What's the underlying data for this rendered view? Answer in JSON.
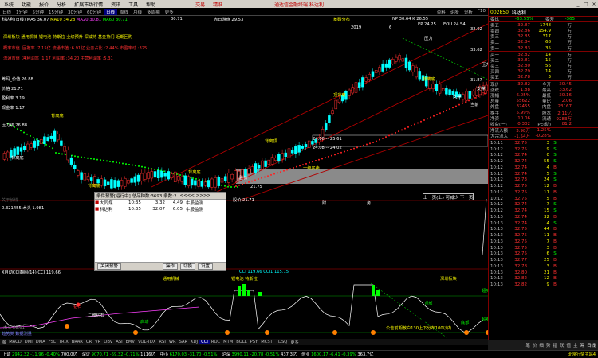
{
  "window": {
    "title": "通达信金融终端 科达利",
    "menu": [
      "系统",
      "功能",
      "报价",
      "分析",
      "扩展市场行情",
      "资讯",
      "工具",
      "帮助"
    ],
    "trade_label": "交易",
    "weituo_label": "精准"
  },
  "toolbar": {
    "items": [
      "日线",
      "1分钟",
      "5分钟",
      "15分钟",
      "30分钟",
      "60分钟",
      "日线",
      "周线",
      "月线",
      "多周期",
      "更多"
    ],
    "active_index": 6,
    "right_items": [
      "资料",
      "论股",
      "分析",
      "F10"
    ]
  },
  "chart_header": {
    "stock": "科达利(日线)",
    "ma5": "MA5 36.07",
    "ma10": "MA10 34.28",
    "ma20": "MA20 30.81",
    "ma60": "MA60 30.71",
    "ma120": "30.71",
    "extra": "赤日游盘 29.53",
    "extra2": "筹码分布",
    "np": "NP 30.64",
    "ma_lbl": "K",
    "rt": "NP 30.64  K 26.55",
    "ep": "EP 24.25",
    "eo": "EOU 24.54",
    "rt2": "24.49",
    "rt3": "32.02",
    "rt4": "33.62",
    "rt5": "31.87",
    "year": "2019",
    "year2": "6"
  },
  "overlay_text": {
    "line1": "深圳板块 通用机械 锂电池 特斯拉 业绩预升 深减持 基金持门 近期回购",
    "line2": "概率市值 :回撤率 :7.15亿 流通市值 :6.91亿 业务占比 :2.44% 市盈率动 :325",
    "line3": "流通市值 :净利润率 :1.17  利润率 :34.20  主营利润率 :5.31",
    "l_a": "筹码_价值 26.88",
    "l_b": "价格 21.71",
    "l_c": "盈利率 3.19",
    "l_d": "现金率 1.17",
    "l_e": "压力线 26.88",
    "l_f": "关于长线",
    "l_g": "0.321455 木头 1.981",
    "mark1": "背离底",
    "mark2": "背离底",
    "mark3": "背离底",
    "mark4": "背离顶",
    "mark5": "顶背离",
    "mark6": "背离底",
    "mark7": "压力",
    "mark8": "支撑",
    "mark9": "压力",
    "mark10": "支撑",
    "mark11": "当前",
    "mark12": "背离底",
    "box1": "24.00 -- 25.61",
    "box2": "24.08 -- 24.02",
    "box3": "一级买卖",
    "box4": "股价",
    "box5": "21.75",
    "box6": "股价 21.71",
    "tick1": "财",
    "tick2": "务",
    "tick3": "目标",
    "tick4": "目标",
    "sep_lbl": "木头 28.61"
  },
  "indicator": {
    "title": "X自动CCI翻图(14) CCI 119.66",
    "vals": "CCI 119.66  CCI1 115.15",
    "labels": [
      "通用机械",
      "锂电池 特斯拉",
      "深圳板块",
      "钻石",
      "二维钻石",
      "超买",
      "超卖",
      "启动",
      "公告前期散户130上下分布100以内",
      "顶部",
      "底部"
    ],
    "left_lbl": "趋势类 数据测量"
  },
  "popup": {
    "title": "条件预警[运行中] 总品种数:3693 条数:2",
    "arrows": "<<<< >>>>",
    "rows": [
      {
        "flag": "大同煤",
        "time": "10:35",
        "price": "3.32",
        "pct": "4.49",
        "sig": "牛股监测"
      },
      {
        "flag": "科达利",
        "time": "10:35",
        "price": "32.07",
        "pct": "6.05",
        "sig": "牛股监测"
      }
    ],
    "buttons": [
      "关闭预警",
      "操作",
      "切换",
      "设置"
    ]
  },
  "tooltip": "上一页(上) 可减少 下一页",
  "right_panel": {
    "code": "002850",
    "name": "科达利",
    "compare": "委比",
    "compare_val": "-63.55%",
    "weicha": "委差",
    "weicha_val": "-365",
    "sells": [
      {
        "l": "卖五",
        "p": "32.87",
        "v": "1748",
        "c": "万"
      },
      {
        "l": "卖四",
        "p": "32.86",
        "v": "154.9",
        "c": "万"
      },
      {
        "l": "卖三",
        "p": "32.85",
        "v": "317",
        "c": "万"
      },
      {
        "l": "卖二",
        "p": "32.84",
        "v": "68",
        "c": "万"
      },
      {
        "l": "卖一",
        "p": "32.83",
        "v": "35",
        "c": "万"
      }
    ],
    "buys": [
      {
        "l": "买一",
        "p": "32.82",
        "v": "14",
        "c": "万"
      },
      {
        "l": "买二",
        "p": "32.81",
        "v": "15",
        "c": "万"
      },
      {
        "l": "买三",
        "p": "32.80",
        "v": "56",
        "c": "万"
      },
      {
        "l": "买四",
        "p": "32.79",
        "v": "14",
        "c": "万"
      },
      {
        "l": "买五",
        "p": "32.78",
        "v": "3",
        "c": "万"
      }
    ],
    "stats": [
      {
        "a": "现价",
        "b": "32.82",
        "c": "今开",
        "d": "30.45"
      },
      {
        "a": "涨跌",
        "b": "1.88",
        "c": "最高",
        "d": "33.62"
      },
      {
        "a": "涨幅",
        "b": "6.05%",
        "c": "最低",
        "d": "30.16"
      },
      {
        "a": "总量",
        "b": "55622",
        "c": "量比",
        "d": "2.06"
      },
      {
        "a": "外盘",
        "b": "32455",
        "c": "内盘",
        "d": "23167"
      },
      {
        "a": "换手",
        "b": "5.99%",
        "c": "股本",
        "d": "2.11亿"
      },
      {
        "a": "净资",
        "b": "10.06",
        "c": "流通",
        "d": "9283万"
      },
      {
        "a": "收益(一)",
        "b": "0.302",
        "c": "PE(动)",
        "d": "81.2"
      }
    ],
    "flow": [
      {
        "a": "净流入额",
        "b": "3.98万",
        "c": "1.25%"
      },
      {
        "a": "大宗流入",
        "b": "-1.54万",
        "c": "-0.28%"
      }
    ],
    "ticks": [
      {
        "t": "10:11",
        "p": "32.75",
        "v": "3",
        "d": "S"
      },
      {
        "t": "10:12",
        "p": "32.75",
        "v": "9",
        "d": "S"
      },
      {
        "t": "10:12",
        "p": "32.74",
        "v": "0",
        "d": "S"
      },
      {
        "t": "10:12",
        "p": "32.74",
        "v": "55",
        "d": "S"
      },
      {
        "t": "10:12",
        "p": "32.74",
        "v": "4",
        "d": "B"
      },
      {
        "t": "10:12",
        "p": "32.74",
        "v": "5",
        "d": "S"
      },
      {
        "t": "10:12",
        "p": "32.73",
        "v": "24",
        "d": "S"
      },
      {
        "t": "10:12",
        "p": "32.75",
        "v": "12",
        "d": "B"
      },
      {
        "t": "10:12",
        "p": "32.75",
        "v": "11",
        "d": "B"
      },
      {
        "t": "10:12",
        "p": "32.75",
        "v": "5",
        "d": "B"
      },
      {
        "t": "10:12",
        "p": "32.74",
        "v": "7",
        "d": "S"
      },
      {
        "t": "10:12",
        "p": "32.74",
        "v": "15",
        "d": "S"
      },
      {
        "t": "10:13",
        "p": "32.74",
        "v": "32",
        "d": "B"
      },
      {
        "t": "10:13",
        "p": "32.74",
        "v": "4",
        "d": "S"
      },
      {
        "t": "10:13",
        "p": "32.75",
        "v": "44",
        "d": "B"
      },
      {
        "t": "10:13",
        "p": "32.75",
        "v": "11",
        "d": "B"
      },
      {
        "t": "10:13",
        "p": "32.75",
        "v": "7",
        "d": "B"
      },
      {
        "t": "10:13",
        "p": "32.75",
        "v": "3",
        "d": "B"
      },
      {
        "t": "10:13",
        "p": "32.75",
        "v": "6",
        "d": "S"
      },
      {
        "t": "10:13",
        "p": "32.77",
        "v": "25",
        "d": "B"
      },
      {
        "t": "10:13",
        "p": "32.78",
        "v": "3",
        "d": "B"
      },
      {
        "t": "10:13",
        "p": "32.80",
        "v": "21",
        "d": "B"
      },
      {
        "t": "10:13",
        "p": "32.82",
        "v": "12",
        "d": "B"
      },
      {
        "t": "10:13",
        "p": "32.82",
        "v": "9",
        "d": "B"
      }
    ],
    "tabs": [
      "笔",
      "价",
      "细",
      "势",
      "指",
      "联",
      "值",
      "主",
      "筹"
    ],
    "bottom_tab": "日线"
  },
  "index_bar": [
    "缩",
    "MACD",
    "DMI",
    "DMA",
    "FSL",
    "TRIX",
    "BRAR",
    "CR",
    "VR",
    "OBV",
    "ASI",
    "EMV",
    "VOL-TDX",
    "RSI",
    "WR",
    "SAR",
    "KDJ",
    "CCI",
    "ROC",
    "MTM",
    "BOLL",
    "PSY",
    "MCST",
    "TDSQ",
    "更多"
  ],
  "status": [
    {
      "k": "上证",
      "v": "2942.32",
      "c": "-11.96",
      "p": "-0.40%",
      "m": "700.0亿"
    },
    {
      "k": "深证",
      "v": "9070.71",
      "c": "-69.32",
      "p": "-0.71%",
      "m": "1116亿"
    },
    {
      "k": "中小",
      "v": "6170.03",
      "c": "-31.70",
      "p": "-0.51%",
      "m": "-"
    },
    {
      "k": "沪深",
      "v": "3990.11",
      "c": "-20.78",
      "p": "-0.51%",
      "m": "437.3亿"
    },
    {
      "k": "创业",
      "v": "1600.17",
      "c": "-6.41",
      "p": "-0.39%",
      "m": "363.7亿"
    }
  ],
  "status_right": "北京行情主站4"
}
